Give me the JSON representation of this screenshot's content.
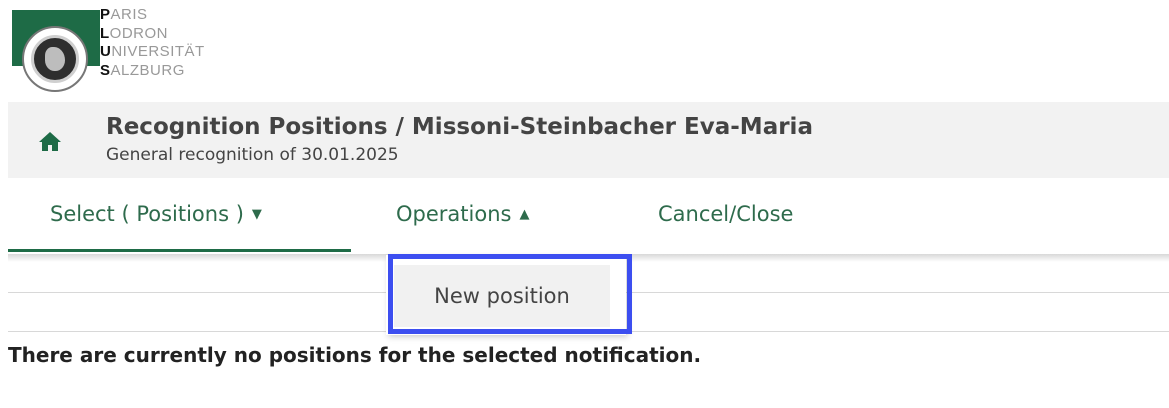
{
  "logo": {
    "lines": [
      {
        "initial": "P",
        "rest": "ARIS"
      },
      {
        "initial": "L",
        "rest": "ODRON"
      },
      {
        "initial": "U",
        "rest": "NIVERSITÄT"
      },
      {
        "initial": "S",
        "rest": "ALZBURG"
      }
    ]
  },
  "header": {
    "title": "Recognition Positions  / Missoni-Steinbacher Eva-Maria",
    "subtitle": "General recognition of 30.01.2025",
    "home_icon": "home-icon"
  },
  "menu": {
    "select_label": "Select ( Positions )",
    "select_caret": "▼",
    "operations_label": "Operations",
    "operations_caret": "▲",
    "cancel_label": "Cancel/Close"
  },
  "dropdown": {
    "items": [
      {
        "label": "New position"
      }
    ]
  },
  "content": {
    "empty_message": "There are currently no positions for the selected notification."
  },
  "colors": {
    "brand_green": "#1e6b46",
    "menu_text": "#2e6b4c",
    "highlight": "#3c4ef0",
    "header_bg": "#f2f2f2"
  }
}
